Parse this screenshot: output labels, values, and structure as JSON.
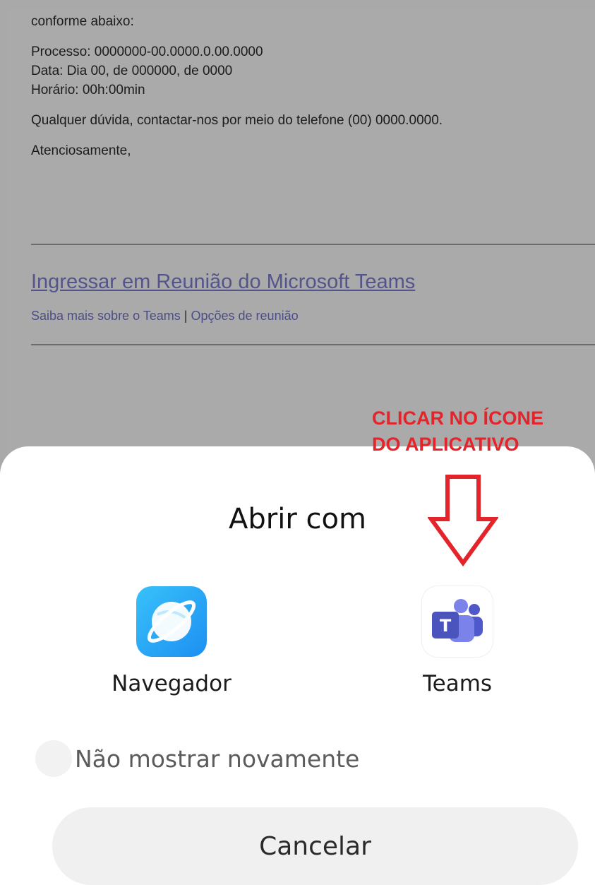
{
  "email": {
    "intro_line": "conforme abaixo:",
    "process": "Processo: 0000000-00.0000.0.00.0000",
    "date": "Data: Dia 00, de 000000, de 0000",
    "time": "Horário: 00h:00min",
    "contact": "Qualquer dúvida, contactar-nos por meio do telefone (00) 0000.0000.",
    "closing": "Atenciosamente,",
    "join_link": "Ingressar em Reunião do Microsoft Teams",
    "learn_more": "Saiba mais sobre o Teams",
    "separator": "|",
    "meeting_options": "Opções de reunião"
  },
  "annotation": {
    "line1": "CLICAR NO ÍCONE",
    "line2": "DO APLICATIVO",
    "color": "#e3242b"
  },
  "dialog": {
    "title": "Abrir com",
    "apps": [
      {
        "label": "Navegador",
        "icon": "browser-planet-icon"
      },
      {
        "label": "Teams",
        "icon": "microsoft-teams-icon"
      }
    ],
    "dont_show_again": "Não mostrar novamente",
    "cancel": "Cancelar"
  }
}
